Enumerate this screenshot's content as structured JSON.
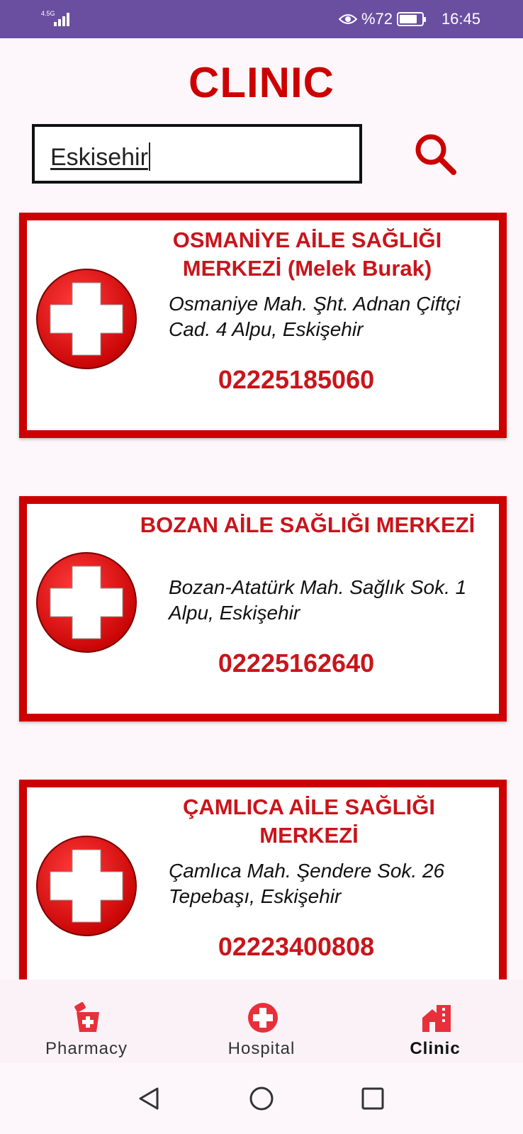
{
  "status_bar": {
    "network": "4.5G",
    "battery_percent": "%72",
    "time": "16:45"
  },
  "page": {
    "title": "CLINIC"
  },
  "search": {
    "value": "Eskisehir"
  },
  "clinics": [
    {
      "name": "OSMANİYE AİLE SAĞLIĞI MERKEZİ (Melek Burak)",
      "address": "Osmaniye Mah. Şht. Adnan Çiftçi Cad. 4 Alpu, Eskişehir",
      "phone": "02225185060"
    },
    {
      "name": "BOZAN AİLE SAĞLIĞI MERKEZİ",
      "address": "Bozan-Atatürk Mah. Sağlık Sok. 1 Alpu, Eskişehir",
      "phone": "02225162640"
    },
    {
      "name": "ÇAMLICA AİLE SAĞLIĞI MERKEZİ",
      "address": "Çamlıca Mah. Şendere Sok. 26 Tepebaşı, Eskişehir",
      "phone": "02223400808"
    }
  ],
  "bottom_nav": {
    "items": [
      {
        "label": "Pharmacy",
        "icon": "pharmacy-icon",
        "active": false
      },
      {
        "label": "Hospital",
        "icon": "hospital-cross-icon",
        "active": false
      },
      {
        "label": "Clinic",
        "icon": "clinic-building-icon",
        "active": true
      }
    ]
  },
  "colors": {
    "accent": "#cc0000",
    "status_bar": "#6a4fa1"
  }
}
